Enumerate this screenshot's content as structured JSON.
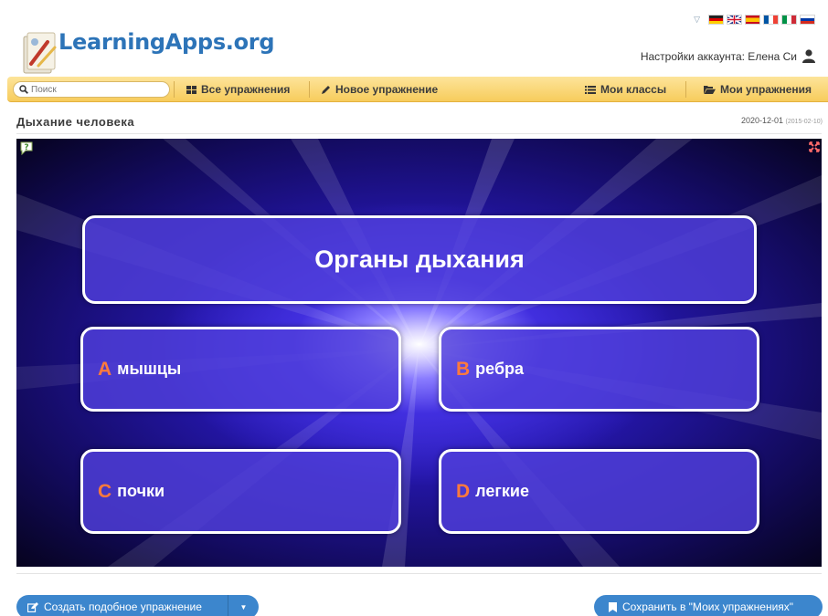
{
  "header": {
    "logo_text": "LearningApps.org",
    "account_label": "Настройки аккаунта: Елена Си",
    "languages": [
      "de",
      "en",
      "es",
      "fr",
      "it",
      "ru"
    ]
  },
  "nav": {
    "search_placeholder": "Поиск",
    "all_exercises": "Все упражнения",
    "new_exercise": "Новое упражнение",
    "my_classes": "Мои классы",
    "my_exercises": "Мои упражнения"
  },
  "exercise": {
    "title": "Дыхание человека",
    "date": "2020-12-01",
    "created_date": "(2015-02-10)",
    "question": "Органы дыхания",
    "answers": [
      {
        "letter": "A",
        "text": "мышцы"
      },
      {
        "letter": "B",
        "text": "ребра"
      },
      {
        "letter": "C",
        "text": "почки"
      },
      {
        "letter": "D",
        "text": "легкие"
      }
    ]
  },
  "footer": {
    "create_similar": "Создать подобное упражнение",
    "save_to_my": "Сохранить в \"Моих упражнениях\""
  },
  "colors": {
    "brand_blue": "#2d74b8",
    "nav_yellow": "#f9d46e",
    "answer_letter": "#ff7a3c",
    "button_blue": "#3c86cd"
  }
}
